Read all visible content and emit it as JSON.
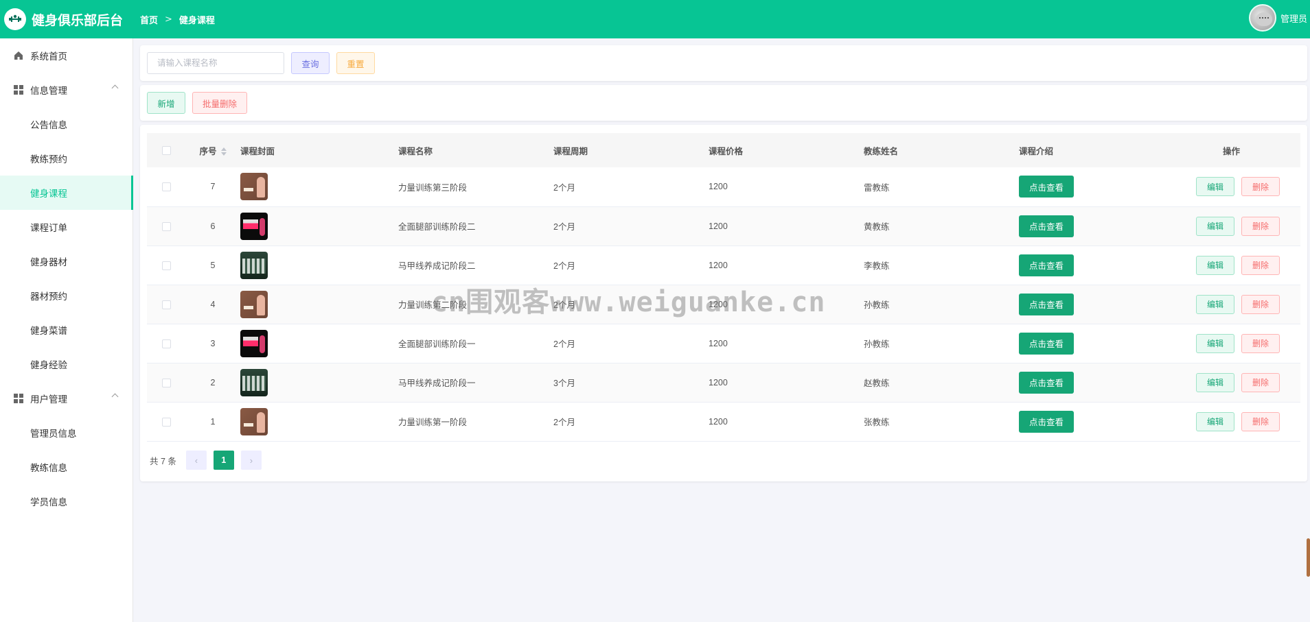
{
  "header": {
    "app_title": "健身俱乐部后台",
    "breadcrumb": [
      "首页",
      "健身课程"
    ],
    "user_name": "管理员",
    "bg_color": "#07c594"
  },
  "sidebar": {
    "items": [
      {
        "label": "系统首页",
        "icon": "home-icon",
        "type": "top"
      },
      {
        "label": "信息管理",
        "icon": "grid-icon",
        "type": "group"
      },
      {
        "label": "公告信息",
        "type": "sub"
      },
      {
        "label": "教练预约",
        "type": "sub"
      },
      {
        "label": "健身课程",
        "type": "sub",
        "active": true
      },
      {
        "label": "课程订单",
        "type": "sub"
      },
      {
        "label": "健身器材",
        "type": "sub"
      },
      {
        "label": "器材预约",
        "type": "sub"
      },
      {
        "label": "健身菜谱",
        "type": "sub"
      },
      {
        "label": "健身经验",
        "type": "sub"
      },
      {
        "label": "用户管理",
        "icon": "grid-icon",
        "type": "group"
      },
      {
        "label": "管理员信息",
        "type": "sub"
      },
      {
        "label": "教练信息",
        "type": "sub"
      },
      {
        "label": "学员信息",
        "type": "sub"
      }
    ]
  },
  "search": {
    "placeholder": "请输入课程名称",
    "query_label": "查询",
    "reset_label": "重置"
  },
  "actions": {
    "add_label": "新增",
    "batch_delete_label": "批量删除"
  },
  "table": {
    "headers": {
      "no": "序号",
      "cover": "课程封面",
      "name": "课程名称",
      "period": "课程周期",
      "price": "课程价格",
      "coach": "教练姓名",
      "intro": "课程介绍",
      "ops": "操作"
    },
    "view_label": "点击查看",
    "edit_label": "编辑",
    "delete_label": "删除",
    "rows": [
      {
        "no": "7",
        "cover": "brown",
        "name": "力量训练第三阶段",
        "period": "2个月",
        "price": "1200",
        "coach": "雷教练"
      },
      {
        "no": "6",
        "cover": "black",
        "name": "全面腿部训练阶段二",
        "period": "2个月",
        "price": "1200",
        "coach": "黄教练"
      },
      {
        "no": "5",
        "cover": "green",
        "name": "马甲线养成记阶段二",
        "period": "2个月",
        "price": "1200",
        "coach": "李教练"
      },
      {
        "no": "4",
        "cover": "brown",
        "name": "力量训练第二阶段",
        "period": "2个月",
        "price": "1200",
        "coach": "孙教练"
      },
      {
        "no": "3",
        "cover": "black",
        "name": "全面腿部训练阶段一",
        "period": "2个月",
        "price": "1200",
        "coach": "孙教练"
      },
      {
        "no": "2",
        "cover": "green",
        "name": "马甲线养成记阶段一",
        "period": "3个月",
        "price": "1200",
        "coach": "赵教练"
      },
      {
        "no": "1",
        "cover": "brown",
        "name": "力量训练第一阶段",
        "period": "2个月",
        "price": "1200",
        "coach": "张教练"
      }
    ]
  },
  "pagination": {
    "total_text": "共 7 条",
    "prev": "‹",
    "current": "1",
    "next": "›"
  },
  "watermark": "cn围观客www.weiguanke.cn"
}
